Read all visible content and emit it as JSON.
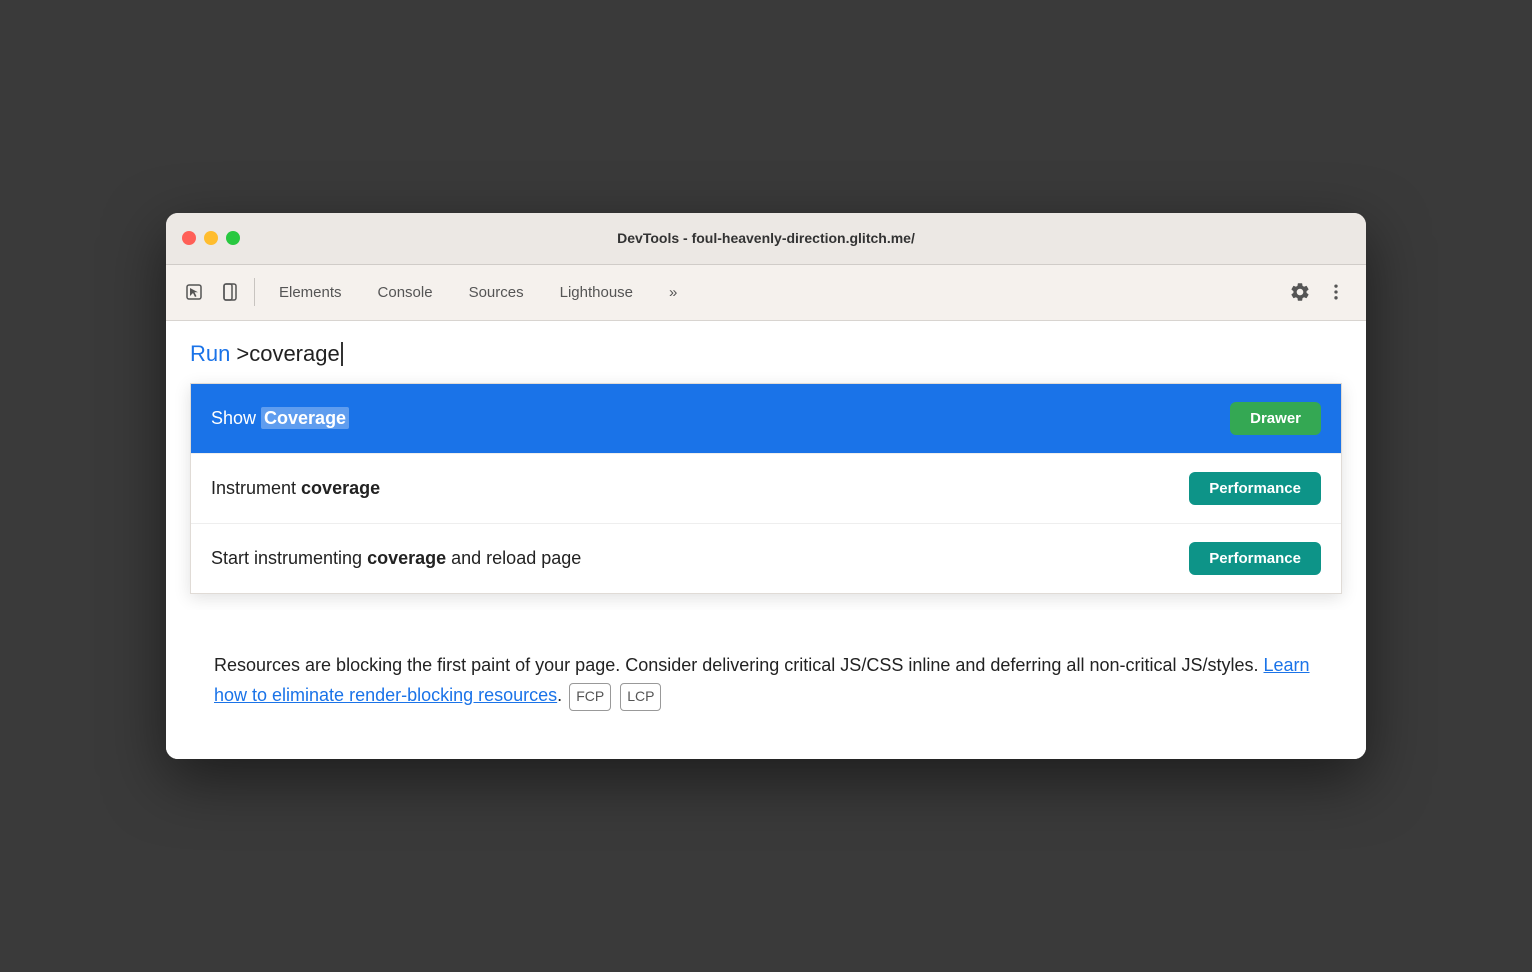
{
  "window": {
    "title": "DevTools - foul-heavenly-direction.glitch.me/"
  },
  "tabs": {
    "elements": "Elements",
    "console": "Console",
    "sources": "Sources",
    "lighthouse": "Lighthouse",
    "more": "»"
  },
  "search": {
    "run_label": "Run",
    "query": ">coverage"
  },
  "dropdown": {
    "items": [
      {
        "text_prefix": "Show ",
        "text_highlight": "Coverage",
        "badge": "Drawer",
        "badge_type": "drawer",
        "selected": true
      },
      {
        "text_prefix": "Instrument ",
        "text_bold": "coverage",
        "badge": "Performance",
        "badge_type": "performance",
        "selected": false
      },
      {
        "text_prefix": "Start instrumenting ",
        "text_bold": "coverage",
        "text_suffix": " and reload page",
        "badge": "Performance",
        "badge_type": "performance",
        "selected": false
      }
    ]
  },
  "body": {
    "text_before_link": "Resources are blocking the first paint of your page. Consider delivering critical JS/CSS inline and deferring all non-critical JS/styles. ",
    "link_text": "Learn how to eliminate render-blocking resources",
    "text_after_link": ".",
    "badge_fcp": "FCP",
    "badge_lcp": "LCP"
  },
  "icons": {
    "cursor_tool": "⬚",
    "device_toggle": "⬜",
    "gear": "⚙",
    "more_vert": "⋮"
  }
}
